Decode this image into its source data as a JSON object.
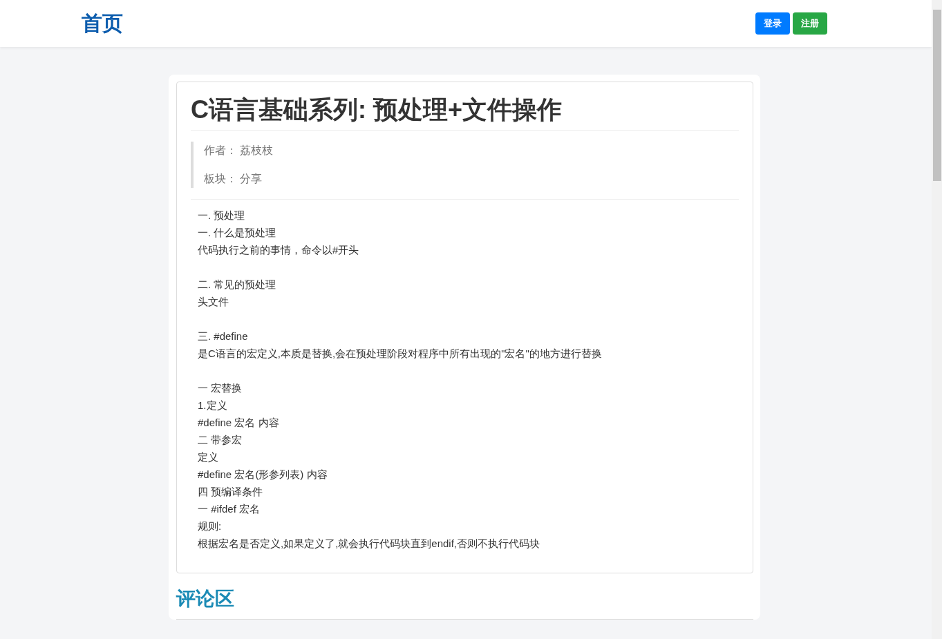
{
  "navbar": {
    "brand": "首页",
    "buttons": [
      {
        "label": "登录",
        "kind": "primary"
      },
      {
        "label": "注册",
        "kind": "success"
      }
    ]
  },
  "article": {
    "title": "C语言基础系列: 预处理+文件操作",
    "meta": [
      {
        "label": "作者：",
        "value": "荔枝枝"
      },
      {
        "label": "板块：",
        "value": "分享"
      }
    ],
    "paragraphs": [
      [
        "一. 预处理",
        "一. 什么是预处理",
        "代码执行之前的事情，命令以#开头"
      ],
      [
        "二. 常见的预处理",
        "头文件"
      ],
      [
        "三. #define",
        "是C语言的宏定义,本质是替换,会在预处理阶段对程序中所有出现的\"宏名\"的地方进行替换"
      ],
      [
        "一 宏替换",
        "1.定义",
        "#define 宏名 内容",
        "二 带参宏",
        "定义",
        "#define 宏名(形参列表) 内容",
        "四 预编译条件",
        "一 #ifdef 宏名",
        "规则:",
        "根据宏名是否定义,如果定义了,就会执行代码块直到endif,否则不执行代码块"
      ]
    ]
  },
  "comments": {
    "heading": "评论区"
  }
}
